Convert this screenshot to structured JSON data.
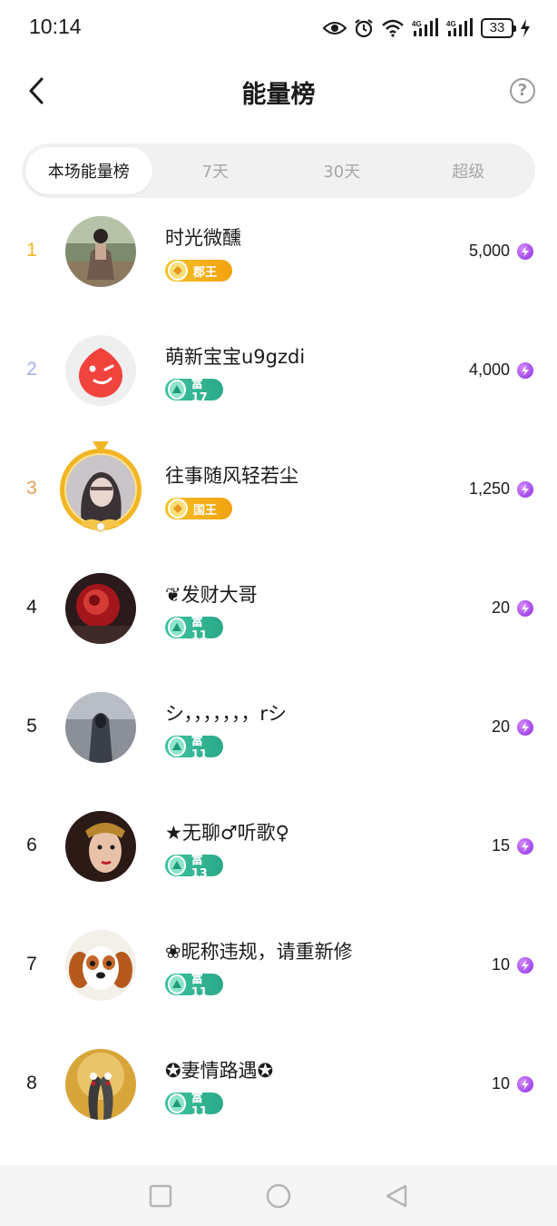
{
  "status_bar": {
    "time": "10:14",
    "battery": "33",
    "network_label": "4G"
  },
  "header": {
    "title": "能量榜",
    "help_symbol": "?"
  },
  "tabs": [
    {
      "label": "本场能量榜",
      "active": true
    },
    {
      "label": "7天",
      "active": false
    },
    {
      "label": "30天",
      "active": false
    },
    {
      "label": "超级",
      "active": false
    }
  ],
  "colors": {
    "rank_1": "#f0b522",
    "rank_2": "#a9aef2",
    "rank_3": "#e0a05a",
    "rank_default": "#1a1a1a",
    "badge_gold": "#f2a20f",
    "badge_green": "#2aa987",
    "energy_icon": "#8a2be2"
  },
  "ranking": [
    {
      "rank": "1",
      "name": "时光微醺",
      "badge": "郡王",
      "badge_type": "gold",
      "score": "5,000",
      "avatar": "photo-woman-outdoor-icon"
    },
    {
      "rank": "2",
      "name": "萌新宝宝u9gzdi",
      "badge": "富17",
      "badge_type": "green",
      "score": "4,000",
      "avatar": "winking-red-mascot-icon"
    },
    {
      "rank": "3",
      "name": "往事随风轻若尘",
      "badge": "国王",
      "badge_type": "gold",
      "score": "1,250",
      "avatar": "photo-girl-portrait-framed-icon"
    },
    {
      "rank": "4",
      "name": "❦发财大哥",
      "badge": "富11",
      "badge_type": "green",
      "score": "20",
      "avatar": "photo-red-rose-icon"
    },
    {
      "rank": "5",
      "name": "シ，，，，，，，rシ",
      "badge": "富11",
      "badge_type": "green",
      "score": "20",
      "avatar": "photo-hooded-figure-icon"
    },
    {
      "rank": "6",
      "name": "★无聊♂听歌♀",
      "badge": "富13",
      "badge_type": "green",
      "score": "15",
      "avatar": "photo-opera-mask-icon"
    },
    {
      "rank": "7",
      "name": "❀昵称违规，请重新修",
      "badge": "富11",
      "badge_type": "green",
      "score": "10",
      "avatar": "photo-puppy-icon"
    },
    {
      "rank": "8",
      "name": "✪妻情路遇✪",
      "badge": "富11",
      "badge_type": "green",
      "score": "10",
      "avatar": "photo-crowned-cranes-icon"
    }
  ],
  "nav_bar": {
    "items": [
      "recent-apps-icon",
      "home-icon",
      "back-triangle-icon"
    ]
  }
}
